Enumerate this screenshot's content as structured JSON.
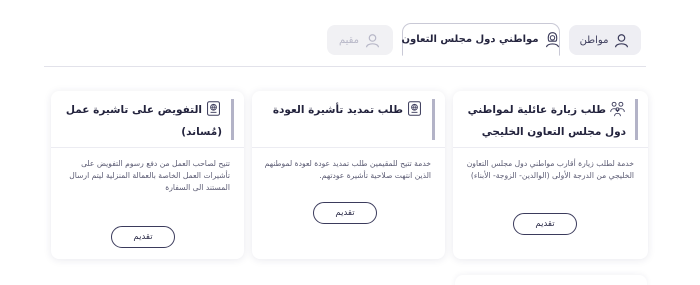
{
  "tabs": [
    {
      "label": "مواطن",
      "icon": "person-icon",
      "state": "inactive"
    },
    {
      "label": "مواطني دول مجلس التعاون",
      "icon": "person-headscarf-icon",
      "state": "active"
    },
    {
      "label": "مقيم",
      "icon": "person-icon",
      "state": "disabled"
    }
  ],
  "cards": [
    {
      "title": "طلب زيارة عائلية لمواطني دول مجلس التعاون الخليجي",
      "icon": "family-icon",
      "description": "خدمة لطلب زيارة أقارب مواطني دول مجلس التعاون الخليجي من الدرجة الأولى (الوالدين- الزوجة- الأبناء)",
      "button": "تقديم"
    },
    {
      "title": "طلب تمديد تأشيرة العودة",
      "icon": "passport-icon",
      "description": "خدمة تتيح للمقيمين طلب تمديد عودة لعودة لموطنهم الذين انتهت صلاحية تأشيرة عودتهم.",
      "button": "تقديم"
    },
    {
      "title": "التفويض على تاشيرة عمل (مُساند)",
      "icon": "passport-icon",
      "description": "تتيح لصاحب العمل من دفع رسوم التفويض على تأشيرات العمل الخاصة بالعمالة المنزلية ليتم ارسال المستند الى السفارة",
      "button": "تقديم"
    }
  ],
  "colors": {
    "accent_bar": "#b3b3c7",
    "button_border": "#3b3b5c",
    "tab_inactive_bg": "#eeeef3"
  }
}
